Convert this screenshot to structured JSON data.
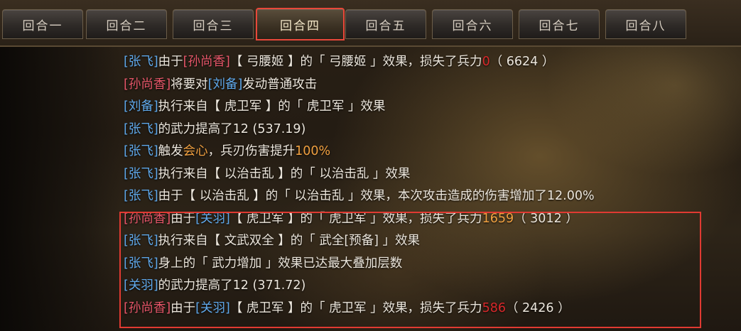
{
  "tabs": [
    {
      "label": "回合一"
    },
    {
      "label": "回合二"
    },
    {
      "label": "回合三"
    },
    {
      "label": "回合四",
      "active": true
    },
    {
      "label": "回合五"
    },
    {
      "label": "回合六"
    },
    {
      "label": "回合七"
    },
    {
      "label": "回合八"
    }
  ],
  "log": [
    {
      "segments": [
        {
          "text": "[张飞]",
          "color": "blue"
        },
        {
          "text": "由于",
          "color": "white"
        },
        {
          "text": "[孙尚香]",
          "color": "red"
        },
        {
          "text": "【 弓腰姬 】的「 弓腰姬 」效果，损失了兵力",
          "color": "white"
        },
        {
          "text": "0",
          "color": "dark-red"
        },
        {
          "text": "（ 6624 ）",
          "color": "white"
        }
      ]
    },
    {
      "segments": [
        {
          "text": "[孙尚香]",
          "color": "red"
        },
        {
          "text": "将要对",
          "color": "white"
        },
        {
          "text": "[刘备]",
          "color": "blue"
        },
        {
          "text": "发动普通攻击",
          "color": "white"
        }
      ]
    },
    {
      "segments": [
        {
          "text": "[刘备]",
          "color": "blue"
        },
        {
          "text": "执行来自【 虎卫军 】的「 虎卫军 」效果",
          "color": "white"
        }
      ]
    },
    {
      "segments": [
        {
          "text": "[张飞]",
          "color": "blue"
        },
        {
          "text": "的武力提高了12 (537.19)",
          "color": "white"
        }
      ]
    },
    {
      "segments": [
        {
          "text": "[张飞]",
          "color": "blue"
        },
        {
          "text": "触发",
          "color": "white"
        },
        {
          "text": "会心",
          "color": "orange"
        },
        {
          "text": "，兵刃伤害提升",
          "color": "white"
        },
        {
          "text": "100%",
          "color": "orange"
        }
      ]
    },
    {
      "segments": [
        {
          "text": "[张飞]",
          "color": "blue"
        },
        {
          "text": "执行来自【 以治击乱 】的「 以治击乱 」效果",
          "color": "white"
        }
      ]
    },
    {
      "segments": [
        {
          "text": "[张飞]",
          "color": "blue"
        },
        {
          "text": "由于【 以治击乱 】的「 以治击乱 」效果，本次攻击造成的伤害增加了12.00%",
          "color": "white"
        }
      ]
    },
    {
      "segments": [
        {
          "text": "[孙尚香]",
          "color": "red"
        },
        {
          "text": "由于",
          "color": "white"
        },
        {
          "text": "[关羽]",
          "color": "blue"
        },
        {
          "text": "【 虎卫军 】的「 虎卫军 」效果，损失了兵力",
          "color": "white"
        },
        {
          "text": "1659",
          "color": "orange"
        },
        {
          "text": "（ 3012 ）",
          "color": "white"
        }
      ]
    },
    {
      "segments": [
        {
          "text": "[张飞]",
          "color": "blue"
        },
        {
          "text": "执行来自【 文武双全 】的「 武全[预备] 」效果",
          "color": "white"
        }
      ]
    },
    {
      "segments": [
        {
          "text": "[张飞]",
          "color": "blue"
        },
        {
          "text": "身上的「 武力增加 」效果已达最大叠加层数",
          "color": "white"
        }
      ]
    },
    {
      "segments": [
        {
          "text": "[关羽]",
          "color": "blue"
        },
        {
          "text": "的武力提高了12 (371.72)",
          "color": "white"
        }
      ]
    },
    {
      "segments": [
        {
          "text": "[孙尚香]",
          "color": "red"
        },
        {
          "text": "由于",
          "color": "white"
        },
        {
          "text": "[关羽]",
          "color": "blue"
        },
        {
          "text": "【 虎卫军 】的「 虎卫军 」效果，损失了兵力",
          "color": "white"
        },
        {
          "text": "586",
          "color": "dark-red"
        },
        {
          "text": "（ 2426 ）",
          "color": "white"
        }
      ]
    }
  ]
}
